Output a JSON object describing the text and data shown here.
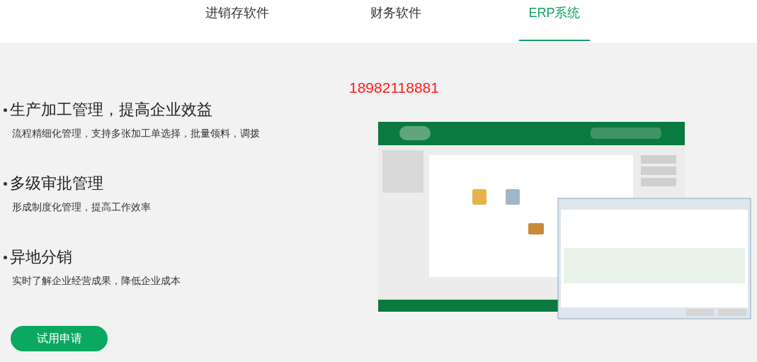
{
  "tabs": [
    {
      "label": "进销存软件",
      "selected": false
    },
    {
      "label": "财务软件",
      "selected": false
    },
    {
      "label": "ERP系统",
      "selected": true
    }
  ],
  "phone": "18982118881",
  "features": [
    {
      "title": "生产加工管理，提高企业效益",
      "description": "流程精细化管理，支持多张加工单选择，批量领料，调拨"
    },
    {
      "title": "多级审批管理",
      "description": "形成制度化管理，提高工作效率"
    },
    {
      "title": "异地分销",
      "description": "实时了解企业经营成果，降低企业成本"
    }
  ],
  "trial_button": "试用申请"
}
